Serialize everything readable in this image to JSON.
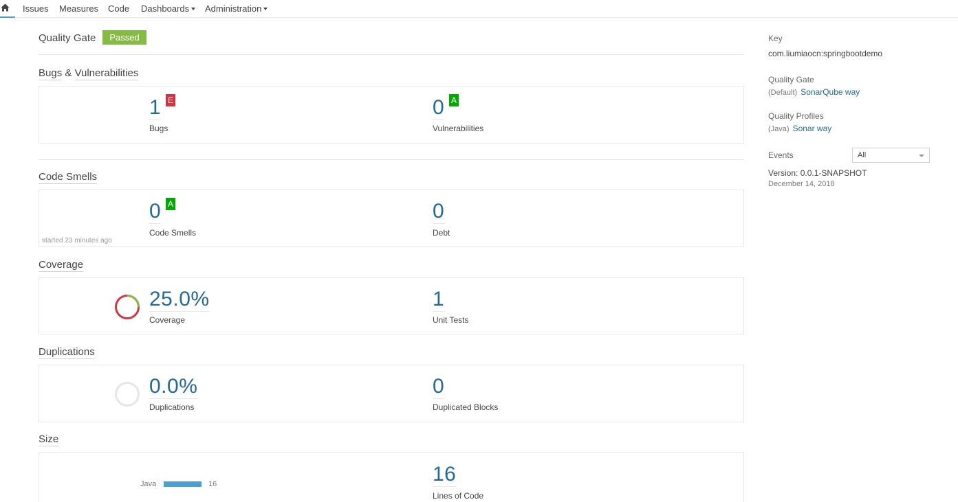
{
  "nav": {
    "items": [
      "Issues",
      "Measures",
      "Code",
      "Dashboards",
      "Administration"
    ]
  },
  "quality_gate": {
    "title": "Quality Gate",
    "status": "Passed"
  },
  "sections": {
    "bugs_vulns": {
      "title_a": "Bugs",
      "amp": "&",
      "title_b": "Vulnerabilities"
    },
    "code_smells": {
      "title": "Code Smells"
    },
    "coverage": {
      "title": "Coverage"
    },
    "duplications": {
      "title": "Duplications"
    },
    "size": {
      "title": "Size"
    }
  },
  "metrics": {
    "bugs": {
      "value": "1",
      "rating": "E",
      "label": "Bugs"
    },
    "vulnerabilities": {
      "value": "0",
      "rating": "A",
      "label": "Vulnerabilities"
    },
    "code_smells": {
      "value": "0",
      "rating": "A",
      "label": "Code Smells"
    },
    "debt": {
      "value": "0",
      "label": "Debt"
    },
    "started": "started 23 minutes ago",
    "coverage": {
      "value": "25.0%",
      "label": "Coverage",
      "fraction": 0.25
    },
    "unit_tests": {
      "value": "1",
      "label": "Unit Tests"
    },
    "duplications": {
      "value": "0.0%",
      "label": "Duplications",
      "fraction": 0.0
    },
    "duplicated_blocks": {
      "value": "0",
      "label": "Duplicated Blocks"
    },
    "language": {
      "name": "Java",
      "value": "16"
    },
    "lines_of_code": {
      "value": "16",
      "label": "Lines of Code"
    }
  },
  "sidebar": {
    "key_label": "Key",
    "key_value": "com.liumiaocn:springbootdemo",
    "qg_label": "Quality Gate",
    "qg_default": "(Default)",
    "qg_link": "SonarQube way",
    "qp_label": "Quality Profiles",
    "qp_lang": "(Java)",
    "qp_link": "Sonar way",
    "events_label": "Events",
    "events_filter": "All",
    "version_label": "Version:",
    "version_value": "0.0.1-SNAPSHOT",
    "version_date": "December 14, 2018"
  },
  "colors": {
    "accent": "#236a97",
    "passed": "#85bb43",
    "rating_e": "#d4333f",
    "rating_a": "#00aa00",
    "coverage_bad": "#d4333f",
    "coverage_good": "#85bb43",
    "bar": "#4b9fd5"
  }
}
